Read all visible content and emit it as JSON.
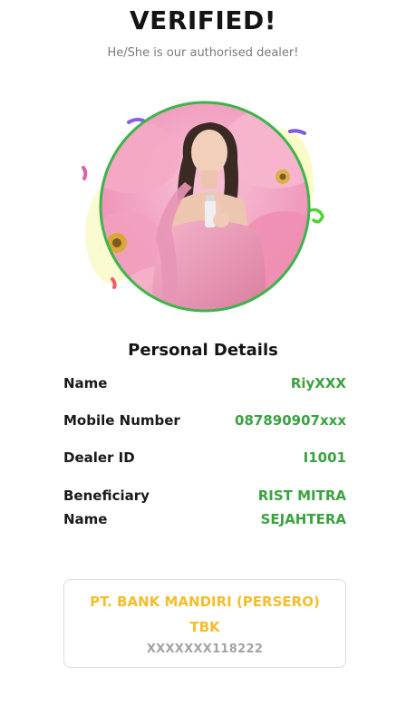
{
  "header": {
    "title": "VERIFIED!",
    "subtitle": "He/She is our authorised dealer!"
  },
  "profile": {
    "photo_icon": "dealer-profile-photo",
    "accent_colors": {
      "ring": "#3bb54a",
      "confetti_purple": "#8a5cf0",
      "confetti_pink": "#e05fa8",
      "confetti_green": "#53d137",
      "confetti_red": "#f05a6a",
      "blob_yellow": "#fbfbc8"
    }
  },
  "details": {
    "heading": "Personal Details",
    "name_label": "Name",
    "name_value": "RiyXXX",
    "mobile_label": "Mobile Number",
    "mobile_value": "087890907xxx",
    "dealer_id_label": "Dealer ID",
    "dealer_id_value": "I1001",
    "beneficiary_label": "Beneficiary Name",
    "beneficiary_value": "RIST MITRA SEJAHTERA"
  },
  "bank": {
    "name": "PT. BANK MANDIRI (PERSERO) TBK",
    "account": "XXXXXXX118222"
  }
}
